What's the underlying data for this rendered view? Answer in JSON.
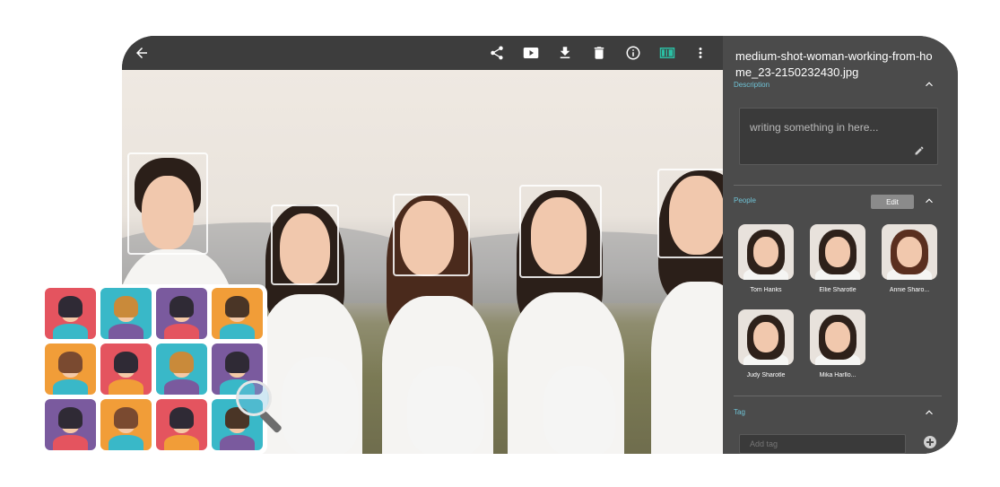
{
  "window": {
    "title": "medium-shot-woman-working-from-home_23-2150232430.jpg"
  },
  "toolbar": {
    "back_icon": "arrow-left-icon",
    "actions": [
      {
        "name": "share-icon",
        "label": "Share"
      },
      {
        "name": "slideshow-icon",
        "label": "Slideshow"
      },
      {
        "name": "download-icon",
        "label": "Download"
      },
      {
        "name": "delete-icon",
        "label": "Delete"
      },
      {
        "name": "info-icon",
        "label": "Info"
      },
      {
        "name": "people-panel-icon",
        "label": "Panel"
      },
      {
        "name": "more-vert-icon",
        "label": "More"
      }
    ],
    "active_color": "#2bbfa4"
  },
  "panel": {
    "description": {
      "label": "Description",
      "placeholder": "writing something in here..."
    },
    "people": {
      "label": "People",
      "edit_label": "Edit",
      "items": [
        {
          "name": "Tom Hanks"
        },
        {
          "name": "Ellie Sharotle"
        },
        {
          "name": "Annie Sharo..."
        },
        {
          "name": "Judy Sharotle"
        },
        {
          "name": "Mika Harllo..."
        }
      ]
    },
    "tag": {
      "label": "Tag",
      "placeholder": "Add tag"
    }
  },
  "colors": {
    "panel_bg": "#4b4b4b",
    "accent": "#6fc3d6",
    "avatar_tiles": [
      "#e4545f",
      "#39b8c8",
      "#7a5a9e",
      "#f19d38",
      "#f19d38",
      "#e4545f",
      "#39b8c8",
      "#7a5a9e",
      "#7a5a9e",
      "#f19d38",
      "#e4545f",
      "#39b8c8"
    ]
  }
}
